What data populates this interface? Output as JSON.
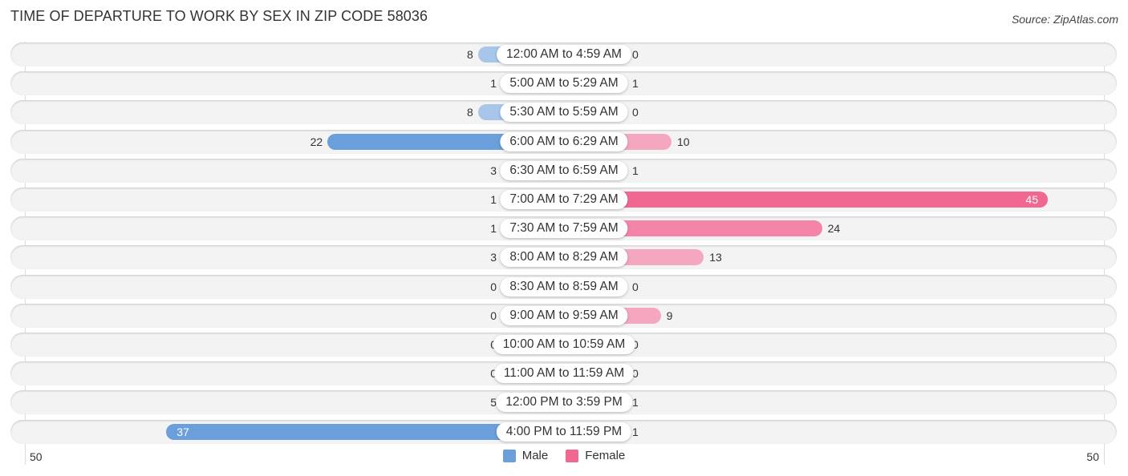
{
  "title": "TIME OF DEPARTURE TO WORK BY SEX IN ZIP CODE 58036",
  "source": "Source: ZipAtlas.com",
  "colors": {
    "male_strong": "#6a9fdc",
    "male_light": "#a7c6ea",
    "female_strong": "#f06890",
    "female_light": "#f5a7bf"
  },
  "chart_data": {
    "type": "bar",
    "orientation": "horizontal-diverging",
    "title": "TIME OF DEPARTURE TO WORK BY SEX IN ZIP CODE 58036",
    "categories": [
      "12:00 AM to 4:59 AM",
      "5:00 AM to 5:29 AM",
      "5:30 AM to 5:59 AM",
      "6:00 AM to 6:29 AM",
      "6:30 AM to 6:59 AM",
      "7:00 AM to 7:29 AM",
      "7:30 AM to 7:59 AM",
      "8:00 AM to 8:29 AM",
      "8:30 AM to 8:59 AM",
      "9:00 AM to 9:59 AM",
      "10:00 AM to 10:59 AM",
      "11:00 AM to 11:59 AM",
      "12:00 PM to 3:59 PM",
      "4:00 PM to 11:59 PM"
    ],
    "series": [
      {
        "name": "Male",
        "values": [
          8,
          1,
          8,
          22,
          3,
          1,
          1,
          3,
          0,
          0,
          0,
          0,
          5,
          37
        ]
      },
      {
        "name": "Female",
        "values": [
          0,
          1,
          0,
          10,
          1,
          45,
          24,
          13,
          0,
          9,
          0,
          0,
          1,
          1
        ]
      }
    ],
    "xlim": [
      -50,
      50
    ],
    "axis_tick_labels": {
      "left": "50",
      "right": "50"
    },
    "legend": [
      "Male",
      "Female"
    ],
    "legend_position": "bottom-center",
    "xlabel": "",
    "ylabel": "",
    "grid": false
  }
}
